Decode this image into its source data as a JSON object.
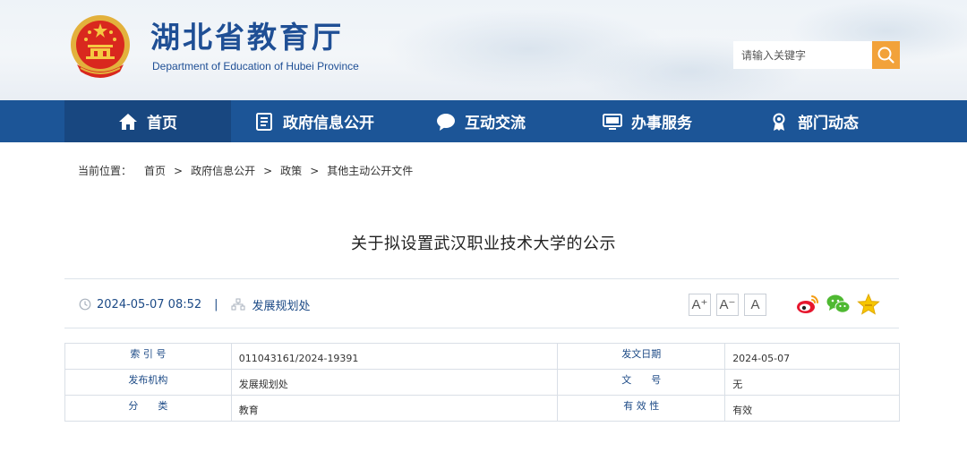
{
  "header": {
    "site_title": "湖北省教育厅",
    "site_subtitle": "Department of Education of Hubei Province",
    "search_placeholder": "请输入关键字",
    "brand_blue": "#1f4f95",
    "accent_orange": "#f2a23a"
  },
  "nav": {
    "background": "#1c5597",
    "items": [
      {
        "label": "首页",
        "icon": "home-icon"
      },
      {
        "label": "政府信息公开",
        "icon": "document-icon"
      },
      {
        "label": "互动交流",
        "icon": "chat-bubble-icon"
      },
      {
        "label": "办事服务",
        "icon": "monitor-icon"
      },
      {
        "label": "部门动态",
        "icon": "award-icon"
      }
    ]
  },
  "breadcrumb": {
    "prefix": "当前位置：",
    "items": [
      "首页",
      "政府信息公开",
      "政策",
      "其他主动公开文件"
    ],
    "separator": ">"
  },
  "article": {
    "title": "关于拟设置武汉职业技术大学的公示",
    "date": "2024-05-07 08:52",
    "divider": "|",
    "source": "发展规划处"
  },
  "toolbar": {
    "font_large": "A⁺",
    "font_medium": "A⁻",
    "font_normal": "A",
    "share_icons": [
      "weibo-icon",
      "wechat-icon",
      "favorite-star-icon"
    ]
  },
  "info_table": {
    "rows": [
      [
        {
          "label": "索 引 号",
          "value": "011043161/2024-19391"
        },
        {
          "label": "发文日期",
          "value": "2024-05-07"
        }
      ],
      [
        {
          "label": "发布机构",
          "value": "发展规划处"
        },
        {
          "label": "文　　号",
          "value": "无"
        }
      ],
      [
        {
          "label": "分　　类",
          "value": "教育"
        },
        {
          "label": "有 效 性",
          "value": "有效"
        }
      ]
    ]
  }
}
